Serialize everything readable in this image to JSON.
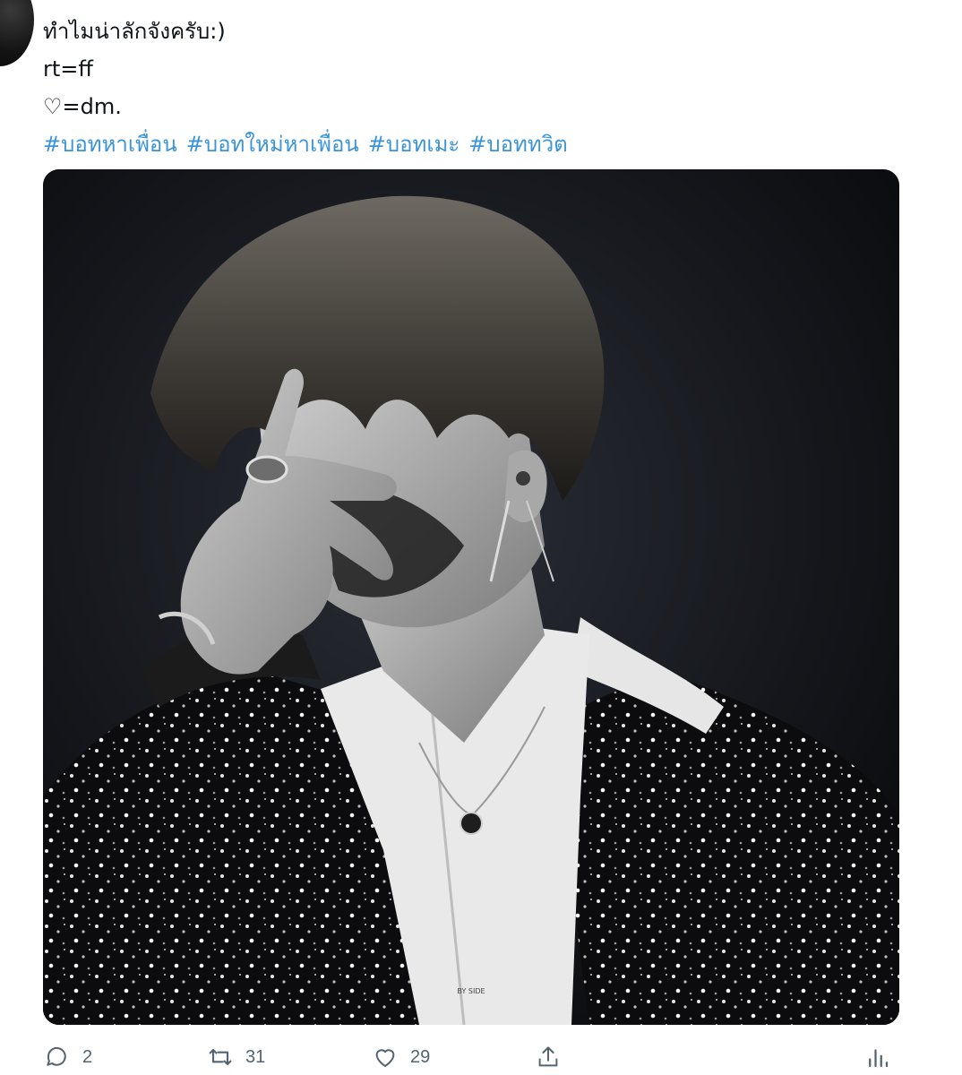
{
  "tweet": {
    "lines": [
      "ทำไมน่าลักจังครับ:)",
      "rt=ff",
      "♡=dm."
    ],
    "hashtags": [
      "#บอทหาเพื่อน",
      "#บอทใหม่หาเพื่อน",
      "#บอทเมะ",
      "#บอททวิต"
    ]
  },
  "media": {
    "watermark": "BY SIDE"
  },
  "actions": {
    "reply_count": "2",
    "retweet_count": "31",
    "like_count": "29"
  },
  "colors": {
    "hashtag": "#3b94d9",
    "icon": "#536471",
    "text": "#0f1419"
  }
}
